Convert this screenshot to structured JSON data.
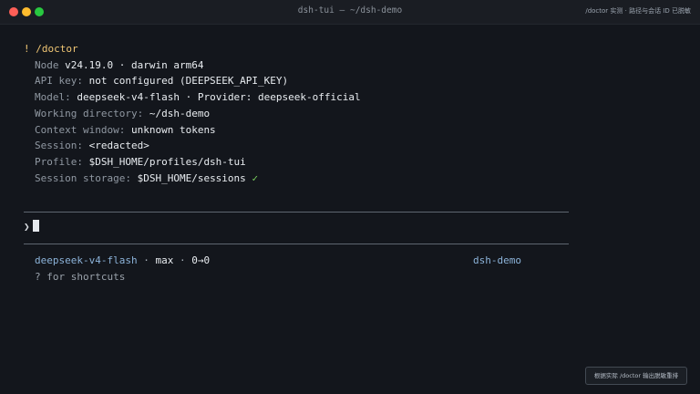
{
  "window": {
    "title": "dsh-tui — ~/dsh-demo",
    "corner_note": "/doctor 实测 · 路径与会话 ID 已脱敏"
  },
  "doctor": {
    "command": "! /doctor",
    "node": {
      "label": "Node",
      "value": "v24.19.0 · darwin arm64"
    },
    "api_key": {
      "label": "API key:",
      "value": "not configured (DEEPSEEK_API_KEY)"
    },
    "model": {
      "label": "Model:",
      "value": "deepseek-v4-flash · Provider: deepseek-official"
    },
    "working_directory": {
      "label": "Working directory:",
      "value": "~/dsh-demo"
    },
    "context_window": {
      "label": "Context window:",
      "value": "unknown tokens"
    },
    "session": {
      "label": "Session:",
      "value": "<redacted>"
    },
    "profile": {
      "label": "Profile:",
      "value": "$DSH_HOME/profiles/dsh-tui"
    },
    "session_storage": {
      "label": "Session storage:",
      "value": "$DSH_HOME/sessions",
      "check": "✓"
    }
  },
  "prompt": {
    "symbol": "❯"
  },
  "status": {
    "model": "deepseek-v4-flash",
    "separator1": " · ",
    "mode": "max",
    "separator2": " · ",
    "tokens": "0→0",
    "project": "dsh-demo",
    "hint": "? for shortcuts"
  },
  "footer": {
    "badge": "根据实际 /doctor 输出脱敏重排"
  },
  "colors": {
    "background": "#13161c",
    "command": "#f0c674",
    "model": "#8cb3d9",
    "check": "#7ad05f"
  }
}
